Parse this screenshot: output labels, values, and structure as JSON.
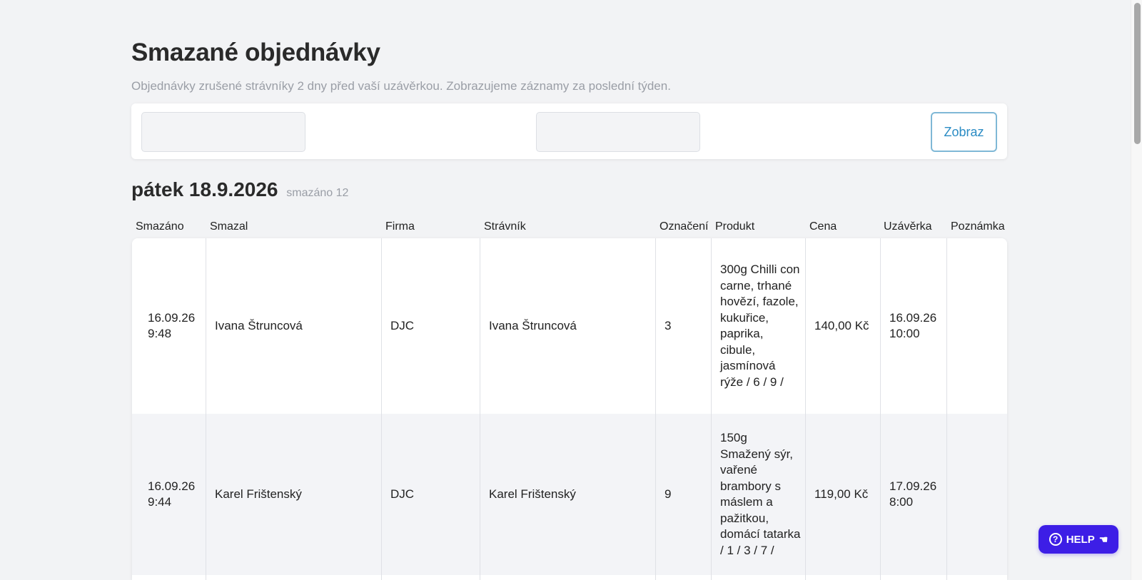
{
  "page": {
    "title": "Smazané objednávky",
    "subtitle": "Objednávky zrušené strávníky 2 dny před vaší uzávěrkou. Zobrazujeme záznamy za poslední týden."
  },
  "filters": {
    "from_value": "",
    "to_value": "",
    "show_button": "Zobraz"
  },
  "day": {
    "heading": "pátek 18.9.2026",
    "count": "smazáno 12"
  },
  "table": {
    "headers": [
      "Smazáno",
      "Smazal",
      "Firma",
      "Strávník",
      "Označení",
      "Produkt",
      "Cena",
      "Uzávěrka",
      "Poznámka"
    ],
    "rows": [
      {
        "deleted_date": "16.09.26",
        "deleted_time": "9:48",
        "deleted_by": "Ivana Štruncová",
        "company": "DJC",
        "diner": "Ivana Štruncová",
        "mark": "3",
        "product": "300g Chilli con carne, trhané hovězí, fazole, kukuřice, paprika, cibule, jasmínová rýže / 6 / 9 /",
        "price": "140,00 Kč",
        "deadline_date": "16.09.26",
        "deadline_time": "10:00",
        "note": ""
      },
      {
        "deleted_date": "16.09.26",
        "deleted_time": "9:44",
        "deleted_by": "Karel Frištenský",
        "company": "DJC",
        "diner": "Karel Frištenský",
        "mark": "9",
        "product": "150g Smažený sýr, vařené brambory s máslem a pažitkou, domácí tatarka / 1 / 3 / 7 /",
        "price": "119,00 Kč",
        "deadline_date": "17.09.26",
        "deadline_time": "8:00",
        "note": ""
      }
    ]
  },
  "help": {
    "label": "HELP"
  },
  "icons": {
    "help": "question-circle-icon",
    "hand": "pointing-hand-icon"
  },
  "colors": {
    "accent": "#2b8cc4",
    "help_button": "#3d1ee6",
    "background": "#f2f3f5"
  }
}
